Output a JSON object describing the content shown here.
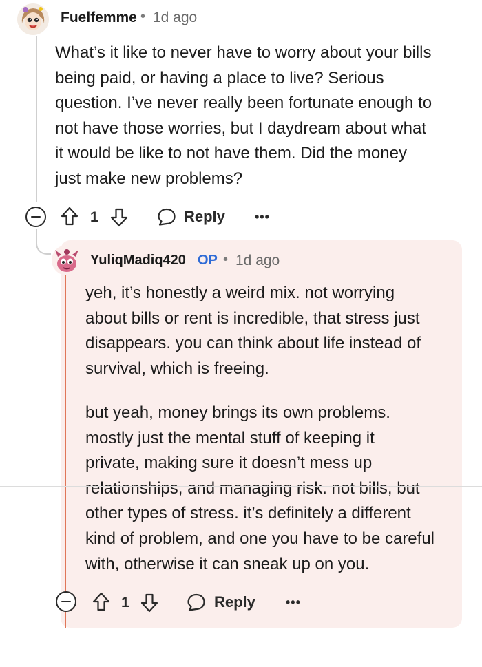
{
  "comment": {
    "username": "Fuelfemme",
    "separator": "•",
    "time": "1d ago",
    "body": [
      "What’s it like to never have to worry about your bills",
      "being paid, or having a place to live? Serious",
      "question. I’ve never really been fortunate enough to",
      "not have those worries, but I daydream about what",
      "it would be like to not have them. Did the money",
      "just make new problems?"
    ],
    "votes": "1",
    "reply_label": "Reply",
    "more_label": "•••",
    "avatar_icon": "cartoon-avatar-icon"
  },
  "reply": {
    "username": "YuliqMadiq420",
    "op_badge": "OP",
    "separator": "•",
    "time": "1d ago",
    "paragraph1": [
      "yeh, it’s honestly a weird mix. not worrying",
      "about bills or rent is incredible, that stress just",
      "disappears. you can think about life instead of",
      "survival, which is freeing."
    ],
    "paragraph2": [
      "but yeah, money brings its own problems.",
      "mostly just the mental stuff of keeping it",
      "private, making sure it doesn’t mess up",
      "relationships, and managing risk. not bills, but",
      "other types of stress. it’s definitely a different",
      "kind of problem, and one you have to be careful",
      "with, otherwise it can sneak up on you."
    ],
    "votes": "1",
    "reply_label": "Reply",
    "more_label": "•••",
    "avatar_icon": "pink-creature-avatar-icon",
    "accent_color": "#e07659",
    "background_color": "#fbeeec"
  }
}
